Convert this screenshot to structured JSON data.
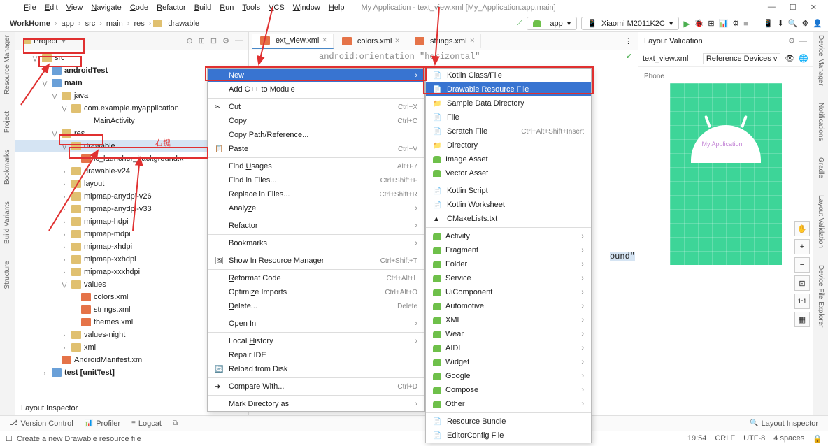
{
  "title": "My Application - text_view.xml [My_Application.app.main]",
  "menu": [
    "File",
    "Edit",
    "View",
    "Navigate",
    "Code",
    "Refactor",
    "Build",
    "Run",
    "Tools",
    "VCS",
    "Window",
    "Help"
  ],
  "breadcrumbs": [
    "WorkHome",
    "app",
    "src",
    "main",
    "res",
    "drawable"
  ],
  "device": "Xiaomi M2011K2C",
  "run_config": "app",
  "project_label": "Project",
  "tree": [
    {
      "d": 1,
      "c": "v",
      "ic": "fold",
      "t": "src",
      "box": true
    },
    {
      "d": 2,
      "c": ">",
      "ic": "fold-blue",
      "t": "androidTest",
      "b": true
    },
    {
      "d": 2,
      "c": "v",
      "ic": "fold-blue",
      "t": "main",
      "b": true
    },
    {
      "d": 3,
      "c": "v",
      "ic": "fold",
      "t": "java"
    },
    {
      "d": 4,
      "c": "v",
      "ic": "fold",
      "t": "com.example.myapplication"
    },
    {
      "d": 5,
      "c": "",
      "ic": "cls",
      "t": "MainActivity"
    },
    {
      "d": 3,
      "c": "v",
      "ic": "fold",
      "t": "res",
      "box": true
    },
    {
      "d": 4,
      "c": "v",
      "ic": "fold",
      "t": "drawable",
      "sel": true,
      "box2": true
    },
    {
      "d": 5,
      "c": "",
      "ic": "xml-ic",
      "t": "ic_launcher_background.x"
    },
    {
      "d": 4,
      "c": ">",
      "ic": "fold",
      "t": "drawable-v24"
    },
    {
      "d": 4,
      "c": ">",
      "ic": "fold",
      "t": "layout"
    },
    {
      "d": 4,
      "c": ">",
      "ic": "fold",
      "t": "mipmap-anydpi-v26"
    },
    {
      "d": 4,
      "c": ">",
      "ic": "fold",
      "t": "mipmap-anydpi-v33"
    },
    {
      "d": 4,
      "c": ">",
      "ic": "fold",
      "t": "mipmap-hdpi"
    },
    {
      "d": 4,
      "c": ">",
      "ic": "fold",
      "t": "mipmap-mdpi"
    },
    {
      "d": 4,
      "c": ">",
      "ic": "fold",
      "t": "mipmap-xhdpi"
    },
    {
      "d": 4,
      "c": ">",
      "ic": "fold",
      "t": "mipmap-xxhdpi"
    },
    {
      "d": 4,
      "c": ">",
      "ic": "fold",
      "t": "mipmap-xxxhdpi"
    },
    {
      "d": 4,
      "c": "v",
      "ic": "fold",
      "t": "values"
    },
    {
      "d": 5,
      "c": "",
      "ic": "xml-ic",
      "t": "colors.xml"
    },
    {
      "d": 5,
      "c": "",
      "ic": "xml-ic",
      "t": "strings.xml"
    },
    {
      "d": 5,
      "c": "",
      "ic": "xml-ic",
      "t": "themes.xml"
    },
    {
      "d": 4,
      "c": ">",
      "ic": "fold",
      "t": "values-night"
    },
    {
      "d": 4,
      "c": ">",
      "ic": "fold",
      "t": "xml"
    },
    {
      "d": 3,
      "c": "",
      "ic": "xml-ic",
      "t": "AndroidManifest.xml"
    },
    {
      "d": 2,
      "c": ">",
      "ic": "fold-blue",
      "t": "test [unitTest]",
      "b": true
    }
  ],
  "annotation_rightclick": "右键",
  "tabs": [
    {
      "t": "ext_view.xml",
      "active": true
    },
    {
      "t": "colors.xml"
    },
    {
      "t": "strings.xml"
    }
  ],
  "code_frag1": "android:orientation=\"horizontal\"",
  "code_frag2": "ound\"",
  "ctx1": [
    {
      "t": "New",
      "sel": true,
      "arrow": true
    },
    {
      "t": "Add C++ to Module"
    },
    {
      "sep": true
    },
    {
      "t": "Cut",
      "sc": "Ctrl+X",
      "ic": "✂"
    },
    {
      "t": "Copy",
      "sc": "Ctrl+C",
      "u": "C"
    },
    {
      "t": "Copy Path/Reference..."
    },
    {
      "t": "Paste",
      "sc": "Ctrl+V",
      "ic": "📋",
      "u": "P"
    },
    {
      "sep": true
    },
    {
      "t": "Find Usages",
      "sc": "Alt+F7",
      "u": "U"
    },
    {
      "t": "Find in Files...",
      "sc": "Ctrl+Shift+F"
    },
    {
      "t": "Replace in Files...",
      "sc": "Ctrl+Shift+R"
    },
    {
      "t": "Analyze",
      "arrow": true,
      "u": "z"
    },
    {
      "sep": true
    },
    {
      "t": "Refactor",
      "arrow": true,
      "u": "R"
    },
    {
      "sep": true
    },
    {
      "t": "Bookmarks",
      "arrow": true
    },
    {
      "sep": true
    },
    {
      "t": "Show In Resource Manager",
      "sc": "Ctrl+Shift+T",
      "ic": "🖼"
    },
    {
      "sep": true
    },
    {
      "t": "Reformat Code",
      "sc": "Ctrl+Alt+L",
      "u": "R"
    },
    {
      "t": "Optimize Imports",
      "sc": "Ctrl+Alt+O",
      "u": "z"
    },
    {
      "t": "Delete...",
      "sc": "Delete",
      "u": "D"
    },
    {
      "sep": true
    },
    {
      "t": "Open In",
      "arrow": true
    },
    {
      "sep": true
    },
    {
      "t": "Local History",
      "arrow": true,
      "u": "H"
    },
    {
      "t": "Repair IDE"
    },
    {
      "t": "Reload from Disk",
      "ic": "🔄"
    },
    {
      "sep": true
    },
    {
      "t": "Compare With...",
      "sc": "Ctrl+D",
      "ic": "➜"
    },
    {
      "sep": true
    },
    {
      "t": "Mark Directory as",
      "arrow": true
    }
  ],
  "ctx2": [
    {
      "t": "Kotlin Class/File",
      "ic": "kt"
    },
    {
      "t": "Drawable Resource File",
      "sel": true,
      "ic": "xml"
    },
    {
      "t": "Sample Data Directory",
      "ic": "fold"
    },
    {
      "t": "File",
      "ic": "file"
    },
    {
      "t": "Scratch File",
      "sc": "Ctrl+Alt+Shift+Insert",
      "ic": "file"
    },
    {
      "t": "Directory",
      "ic": "fold"
    },
    {
      "t": "Image Asset",
      "and": true
    },
    {
      "t": "Vector Asset",
      "and": true
    },
    {
      "sep": true
    },
    {
      "t": "Kotlin Script",
      "ic": "kt"
    },
    {
      "t": "Kotlin Worksheet",
      "ic": "kt"
    },
    {
      "t": "CMakeLists.txt",
      "ic": "cm"
    },
    {
      "sep": true
    },
    {
      "t": "Activity",
      "and": true,
      "arrow": true
    },
    {
      "t": "Fragment",
      "and": true,
      "arrow": true
    },
    {
      "t": "Folder",
      "and": true,
      "arrow": true
    },
    {
      "t": "Service",
      "and": true,
      "arrow": true
    },
    {
      "t": "UiComponent",
      "and": true,
      "arrow": true
    },
    {
      "t": "Automotive",
      "and": true,
      "arrow": true
    },
    {
      "t": "XML",
      "and": true,
      "arrow": true
    },
    {
      "t": "Wear",
      "and": true,
      "arrow": true
    },
    {
      "t": "AIDL",
      "and": true,
      "arrow": true
    },
    {
      "t": "Widget",
      "and": true,
      "arrow": true
    },
    {
      "t": "Google",
      "and": true,
      "arrow": true
    },
    {
      "t": "Compose",
      "and": true,
      "arrow": true
    },
    {
      "t": "Other",
      "and": true,
      "arrow": true
    },
    {
      "sep": true
    },
    {
      "t": "Resource Bundle",
      "ic": "file"
    },
    {
      "t": "EditorConfig File",
      "ic": "file"
    }
  ],
  "layout_hdr": "Layout Validation",
  "layout_file": "text_view.xml",
  "ref_dev": "Reference Devices",
  "phone_label": "Phone",
  "app_label": "My Application",
  "left_rail": [
    "Resource Manager",
    "Project",
    "Bookmarks",
    "Build Variants",
    "Structure"
  ],
  "right_rail": [
    "Device Manager",
    "Notifications",
    "Gradle",
    "Layout Validation",
    "Device File Explorer"
  ],
  "bottom": [
    "Version Control",
    "Profiler",
    "Logcat"
  ],
  "bottom_tabs": [
    "Layout Inspector"
  ],
  "bottom_right": "Layout Inspector",
  "status_msg": "Create a new Drawable resource file",
  "status": {
    "time": "19:54",
    "crlf": "CRLF",
    "enc": "UTF-8",
    "indent": "4 spaces"
  }
}
